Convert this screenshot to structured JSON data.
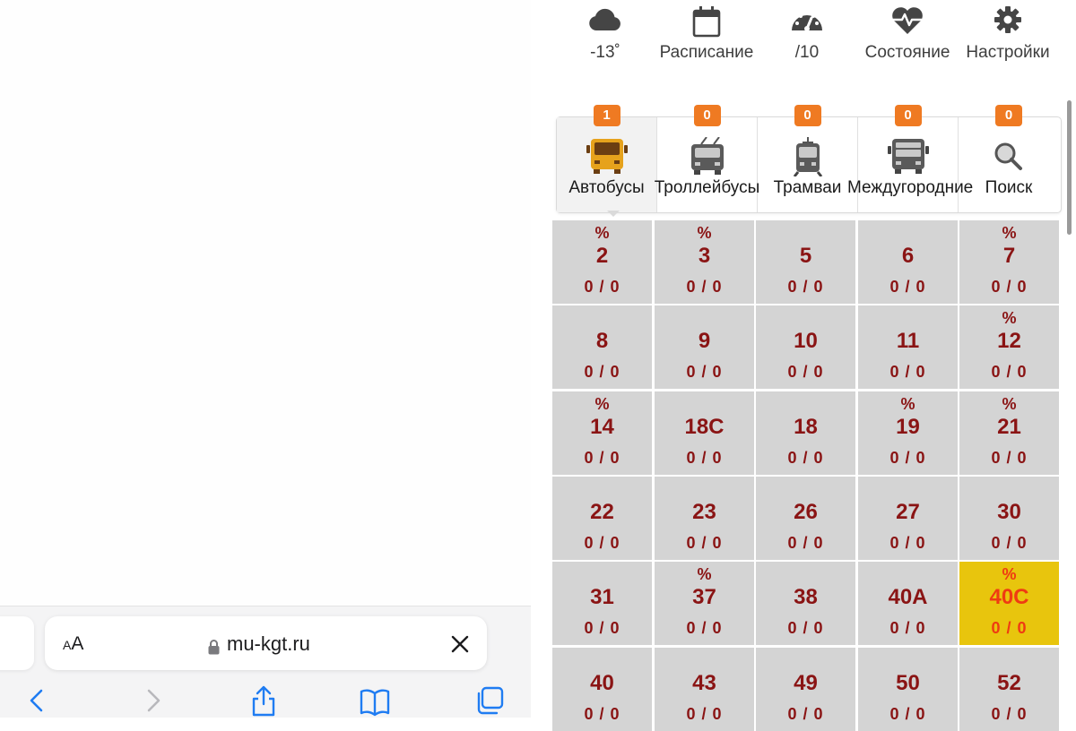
{
  "browser": {
    "address_bar": {
      "text_size_label_small": "A",
      "text_size_label_large": "A",
      "url": "mu-kgt.ru"
    },
    "toolbar": [
      "back-icon",
      "forward-icon",
      "share-icon",
      "bookmarks-icon",
      "tabs-icon"
    ],
    "accent_color": "#1f7cf2"
  },
  "page": {
    "top_nav": [
      {
        "icon": "cloud-icon",
        "label": "-13˚"
      },
      {
        "icon": "calendar-icon",
        "label": "Расписание"
      },
      {
        "icon": "gauge-icon",
        "label": "/10"
      },
      {
        "icon": "heartbeat-icon",
        "label": "Состояние"
      },
      {
        "icon": "gear-icon",
        "label": "Настройки"
      }
    ],
    "transport_types": [
      {
        "icon": "bus-icon",
        "label": "Автобусы",
        "badge": "1",
        "active": true
      },
      {
        "icon": "trolleybus-icon",
        "label": "Троллейбусы",
        "badge": "0"
      },
      {
        "icon": "tram-icon",
        "label": "Трамваи",
        "badge": "0"
      },
      {
        "icon": "intercity-bus-icon",
        "label": "Междугородние",
        "badge": "0"
      },
      {
        "icon": "search-icon",
        "label": "Поиск",
        "badge": "0"
      }
    ],
    "badge_color": "#ef7a22",
    "routes": [
      {
        "number": "2",
        "percent": "%",
        "count": "0 / 0"
      },
      {
        "number": "3",
        "percent": "%",
        "count": "0 / 0"
      },
      {
        "number": "5",
        "percent": "",
        "count": "0 / 0"
      },
      {
        "number": "6",
        "percent": "",
        "count": "0 / 0"
      },
      {
        "number": "7",
        "percent": "%",
        "count": "0 / 0"
      },
      {
        "number": "8",
        "percent": "",
        "count": "0 / 0"
      },
      {
        "number": "9",
        "percent": "",
        "count": "0 / 0"
      },
      {
        "number": "10",
        "percent": "",
        "count": "0 / 0"
      },
      {
        "number": "11",
        "percent": "",
        "count": "0 / 0"
      },
      {
        "number": "12",
        "percent": "%",
        "count": "0 / 0"
      },
      {
        "number": "14",
        "percent": "%",
        "count": "0 / 0"
      },
      {
        "number": "18С",
        "percent": "",
        "count": "0 / 0"
      },
      {
        "number": "18",
        "percent": "",
        "count": "0 / 0"
      },
      {
        "number": "19",
        "percent": "%",
        "count": "0 / 0"
      },
      {
        "number": "21",
        "percent": "%",
        "count": "0 / 0"
      },
      {
        "number": "22",
        "percent": "",
        "count": "0 / 0"
      },
      {
        "number": "23",
        "percent": "",
        "count": "0 / 0"
      },
      {
        "number": "26",
        "percent": "",
        "count": "0 / 0"
      },
      {
        "number": "27",
        "percent": "",
        "count": "0 / 0"
      },
      {
        "number": "30",
        "percent": "",
        "count": "0 / 0"
      },
      {
        "number": "31",
        "percent": "",
        "count": "0 / 0"
      },
      {
        "number": "37",
        "percent": "%",
        "count": "0 / 0"
      },
      {
        "number": "38",
        "percent": "",
        "count": "0 / 0"
      },
      {
        "number": "40А",
        "percent": "",
        "count": "0 / 0"
      },
      {
        "number": "40С",
        "percent": "%",
        "count": "0 / 0",
        "highlight": true
      },
      {
        "number": "40",
        "percent": "",
        "count": "0 / 0"
      },
      {
        "number": "43",
        "percent": "",
        "count": "0 / 0"
      },
      {
        "number": "49",
        "percent": "",
        "count": "0 / 0"
      },
      {
        "number": "50",
        "percent": "",
        "count": "0 / 0"
      },
      {
        "number": "52",
        "percent": "",
        "count": "0 / 0"
      }
    ],
    "tile_color": "#d4d4d4",
    "highlight_color": "#e8c50d",
    "route_text_color": "#8a1414"
  }
}
